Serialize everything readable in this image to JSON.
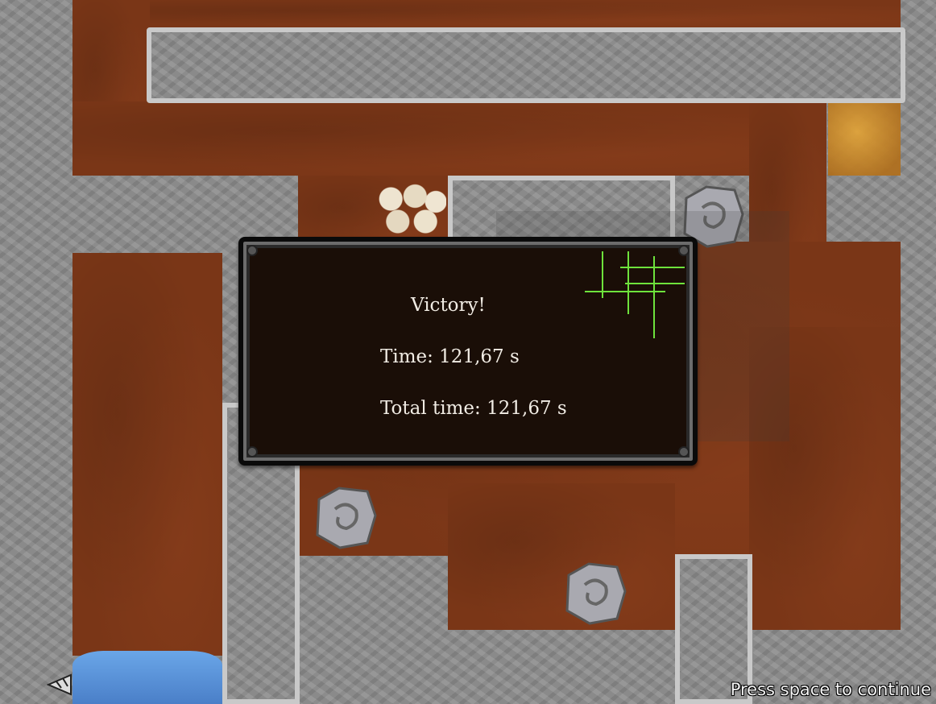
{
  "panel": {
    "title": "Victory!",
    "time": "Time: 121,67 s",
    "total_time": "Total time: 121,67 s"
  },
  "hint": "Press space to continue",
  "colors": {
    "dirt": "#7a3617",
    "stone": "#8d8d8d",
    "panel_bg": "#1a0e07",
    "grid_green": "#6ee23c"
  },
  "tiles": {
    "boulder_icon": "boulder-icon",
    "gravel_icon": "gravel-icon",
    "gold_icon": "gold-ore-icon",
    "water_icon": "water-icon",
    "player_icon": "drill-icon"
  }
}
